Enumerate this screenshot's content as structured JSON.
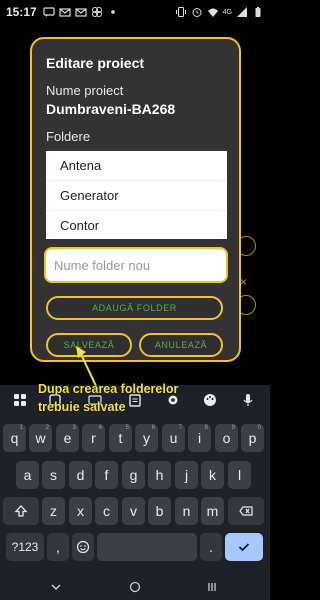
{
  "status_bar": {
    "time": "15:17",
    "network": "4G",
    "notification_icons": [
      "message-icon",
      "mail-icon",
      "mail-icon",
      "pinwheel-icon",
      "dot-icon"
    ],
    "system_icons": [
      "vibrate-icon",
      "alarm-icon",
      "wifi-icon",
      "signal-icon",
      "battery-icon"
    ]
  },
  "dialog": {
    "title": "Editare proiect",
    "name_label": "Nume proiect",
    "name_value": "Dumbraveni-BA268",
    "folders_label": "Foldere",
    "folders": [
      "Antena",
      "Generator",
      "Contor"
    ],
    "input_placeholder": "Nume folder nou",
    "add_button": "ADAUGĂ FOLDER",
    "save_button": "SALVEAZĂ",
    "cancel_button": "ANULEAZĂ"
  },
  "annotation": {
    "text": "Dupa crearea folderelor trebuie salvate"
  },
  "keyboard": {
    "toolbar_icons": [
      "apps-icon",
      "sticker-icon",
      "gif-icon",
      "clipboard-icon",
      "settings-icon",
      "palette-icon",
      "mic-icon"
    ],
    "row1": [
      {
        "key": "q",
        "sup": "1"
      },
      {
        "key": "w",
        "sup": "2"
      },
      {
        "key": "e",
        "sup": "3"
      },
      {
        "key": "r",
        "sup": "4"
      },
      {
        "key": "t",
        "sup": "5"
      },
      {
        "key": "y",
        "sup": "6"
      },
      {
        "key": "u",
        "sup": "7"
      },
      {
        "key": "i",
        "sup": "8"
      },
      {
        "key": "o",
        "sup": "9"
      },
      {
        "key": "p",
        "sup": "0"
      }
    ],
    "row2": [
      "a",
      "s",
      "d",
      "f",
      "g",
      "h",
      "j",
      "k",
      "l"
    ],
    "row3": [
      "z",
      "x",
      "c",
      "v",
      "b",
      "n",
      "m"
    ],
    "numbers_key": "?123",
    "comma_key": ",",
    "period_key": ".",
    "shift_icon": "shift-icon",
    "backspace_icon": "backspace-icon",
    "emoji_icon": "emoji-icon",
    "enter_icon": "check-icon",
    "accent_color": "#a8c7fa"
  },
  "nav_bar": {
    "icons": [
      "keyboard-down-icon",
      "home-icon",
      "recents-icon"
    ]
  },
  "colors": {
    "dialog_border": "#f2c12e",
    "button_text": "#56b14a",
    "annotation": "#f6e233"
  }
}
